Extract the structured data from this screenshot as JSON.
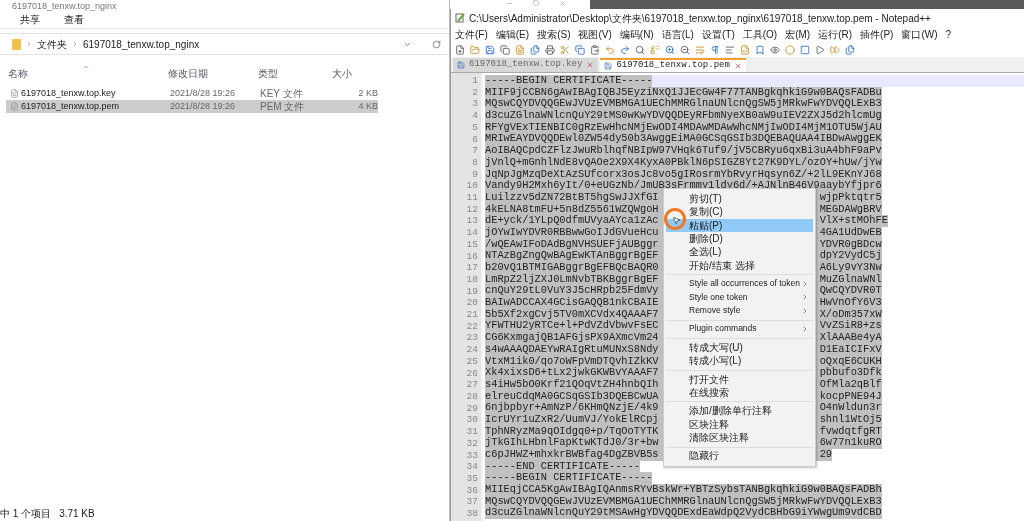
{
  "explorer": {
    "title": "6197018_tenxw.top_nginx",
    "ribbon_tabs": [
      "共享",
      "查看"
    ],
    "breadcrumb": [
      "文件夹",
      "6197018_tenxw.top_nginx"
    ],
    "columns": [
      "名称",
      "修改日期",
      "类型",
      "大小"
    ],
    "files": [
      {
        "name": "6197018_tenxw.top.key",
        "modified": "2021/8/28 19:26",
        "type": "KEY 文件",
        "size": "2 KB",
        "selected": false
      },
      {
        "name": "6197018_tenxw.top.pem",
        "modified": "2021/8/28 19:26",
        "type": "PEM 文件",
        "size": "4 KB",
        "selected": true
      }
    ],
    "status": {
      "count": "中 1 个项目",
      "size": "3.71 KB"
    }
  },
  "notepad": {
    "title": "C:\\Users\\Administrator\\Desktop\\文件夹\\6197018_tenxw.top_nginx\\6197018_tenxw.top.pem - Notepad++",
    "menu": [
      "文件(F)",
      "编辑(E)",
      "搜索(S)",
      "视图(V)",
      "编码(N)",
      "语言(L)",
      "设置(T)",
      "工具(O)",
      "宏(M)",
      "运行(R)",
      "插件(P)",
      "窗口(W)",
      "?"
    ],
    "tabs": [
      {
        "label": "6197018_tenxw.top.key",
        "selected": false
      },
      {
        "label": "6197018_tenxw.top.pem",
        "selected": true
      }
    ],
    "lines": [
      {
        "number": "1",
        "text": "-----BEGIN CERTIFICATE-----",
        "current": true
      },
      {
        "number": "2",
        "text": "MIIF9jCCBN6gAwIBAgIQBJ5EyziNxQ1JJEcGw4F77TANBgkqhkiG9w0BAQsFADBu",
        "current": false
      },
      {
        "number": "3",
        "text": "MQswCQYDVQQGEwJVUzEVMBMGA1UEChMMRGlnaUNlcnQgSW5jMRkwFwYDVQQLExB3",
        "current": false
      },
      {
        "number": "4",
        "text": "d3cuZGlnaWNlcnQuY29tMS0wKwYDVQQDEyRFbmNyeXB0aW9uIEV2ZXJ5d2hlcmUg",
        "current": false
      },
      {
        "number": "5",
        "text": "RFYgVExTIENBIC0gRzEwHhcNMjEwODI4MDAwMDAwWhcNMjIwODI4MjM1OTU5WjAU",
        "current": false
      },
      {
        "number": "6",
        "text": "MRIwEAYDVQQDEwl0ZW54dy50b3AwggEiMA0GCSqGSIb3DQEBAQUAA4IBDwAwggEK",
        "current": false
      },
      {
        "number": "7",
        "text": "AoIBAQCpdCZFlzJwuRblhqfNBIpW97VHqk6Tuf9/jV5CBRyu6qxBi3uA4bhF9aPv",
        "current": false
      },
      {
        "number": "8",
        "text": "jVnlQ+mGnhlNdE8vQAOe2X9X4KyxA0PBklN6pSIGZ8Yt27K9DYL/ozOY+hUw/jYw",
        "current": false
      },
      {
        "number": "9",
        "text": "JqNpJgMzqDeXtAzSUfcorx3osJc8vo5gIRosrmYbRvyrHqsyn6Z/+2lL9EKnYJ68",
        "current": false
      },
      {
        "number": "10",
        "text": "Vandy9H2Mxh6yIt/0+eUGzNb/JmUB3sFrmmy1ldy6d/+AJNlnB46V9aaybYfjpr6",
        "current": false
      },
      {
        "number": "11",
        "text": "Luilzzv5dZN72BtBT5hgSwJJXfGI",
        "tail": "wjpPktqtr5",
        "current": false
      },
      {
        "number": "12",
        "text": "4kELNA8tmFU+5n8dZ5561WZQWgoH",
        "tail": "MEGDAWgBRV",
        "current": false
      },
      {
        "number": "13",
        "text": "dE+yck/1YLpQ0dfmUVyaAYca1zAc",
        "tail": "VlX+stMOhFE",
        "current": false
      },
      {
        "number": "14",
        "text": "jOYwIwYDVR0RBBwwGoIJdGVueHcu",
        "tail": "4GA1UdDwEB",
        "current": false
      },
      {
        "number": "15",
        "text": "/wQEAwIFoDAdBgNVHSUEFjAUBggr",
        "tail": "YDVR0gBDcw",
        "current": false
      },
      {
        "number": "16",
        "text": "NTAzBgZngQwBAgEwKTAnBggrBgEF",
        "tail": "dpY2VydC5j",
        "current": false
      },
      {
        "number": "17",
        "text": "b20vQ1BTMIGABggrBgEFBQcBAQR0",
        "tail": "A6Ly9vY3Nw",
        "current": false
      },
      {
        "number": "18",
        "text": "LmRpZ2ljZXJ0LmNvbTBKBggrBgEF",
        "tail": "MuZGlnaWNl",
        "current": false
      },
      {
        "number": "19",
        "text": "cnQuY29tL0VuY3J5cHRpb25FdmVy",
        "tail": "QwCQYDVR0T",
        "current": false
      },
      {
        "number": "20",
        "text": "BAIwADCCAX4GCisGAQQB1nkCBAIE",
        "tail": "HwVnOfY6V3",
        "current": false
      },
      {
        "number": "21",
        "text": "5b5Xf2xgCvj5TV0mXCVdx4QAAAF7",
        "tail": "X/oDm357xW",
        "current": false
      },
      {
        "number": "22",
        "text": "YFWTHU2yRTCe+l+PdVZdVbwvFsEC",
        "tail": "VvZSiR8+zs",
        "current": false
      },
      {
        "number": "23",
        "text": "CG6KxmgajQB1AFGjsPX9AXmcVm24",
        "tail": "XlAAABe4yA",
        "current": false
      },
      {
        "number": "24",
        "text": "s4wAAAQDAEYwRAIgRtuMUNxS8Ndy",
        "tail": "D1EaICIFxV",
        "current": false
      },
      {
        "number": "25",
        "text": "VtxM1ik0/qo7oWFpVmDTQvhIZkKV",
        "tail": "oQxqE6CUKH",
        "current": false
      },
      {
        "number": "26",
        "text": "Xk4xixsD6+tLx2jwkGKWBvYAAAF7",
        "tail": "pbbufo3Dfk",
        "current": false
      },
      {
        "number": "27",
        "text": "s4iHw5bO0Krf21QOqVtZH4hnbQIh",
        "tail": "OfMla2qBlf",
        "current": false
      },
      {
        "number": "28",
        "text": "elreuCdqMA0GCSqGSIb3DQEBCwUA",
        "tail": "kocpPNE94J",
        "current": false
      },
      {
        "number": "29",
        "text": "6njbpbyr+AmNzP/6KHmQNzjE/4k9",
        "tail": "O4nWldun3r",
        "current": false
      },
      {
        "number": "30",
        "text": "IcrUYr1uZxR2/UumVJ/YokElRCpj",
        "tail": "shnl1WtOj5",
        "current": false
      },
      {
        "number": "31",
        "text": "TphNRyzMa9qOIdgq0+p/TqOoTYTK",
        "tail": "fvwdqtfgRT",
        "current": false
      },
      {
        "number": "32",
        "text": "jTkGIhLHbnlFapKtwKTdJ0/3r+bw",
        "tail": "6w77n1kuRO",
        "current": false
      },
      {
        "number": "33",
        "text": "c6pJHWZ+mhxkrBWBfag4DgZBVB5s",
        "tail": "29",
        "current": false
      },
      {
        "number": "34",
        "text": "-----END CERTIFICATE-----",
        "current": false
      },
      {
        "number": "35",
        "text": "-----BEGIN CERTIFICATE-----",
        "current": false
      },
      {
        "number": "36",
        "text": "MIIEqjCCA5KgAwIBAgIQAnmsRYvBskWr+YBTzSybsTANBgkqhkiG9w0BAQsFADBh",
        "current": false
      },
      {
        "number": "37",
        "text": "MQswCQYDVQQGEwJVUzEVMBMGA1UEChMMRGlnaUNlcnQgSW5jMRkwFwYDVQQLExB3",
        "current": false
      },
      {
        "number": "38",
        "text": "d3cuZGlnaWNlcnQuY29tMSAwHgYDVQQDExdEaWdpQ2VydCBHbG9iYWwgUm9vdCBD",
        "current": false
      }
    ],
    "context_menu": {
      "groups": [
        [
          {
            "label": "剪切(T)",
            "submenu": false,
            "selected": false
          },
          {
            "label": "复制(C)",
            "submenu": false,
            "selected": false
          },
          {
            "label": "粘贴(P)",
            "submenu": false,
            "selected": true
          },
          {
            "label": "删除(D)",
            "submenu": false,
            "selected": false
          },
          {
            "label": "全选(L)",
            "submenu": false,
            "selected": false
          },
          {
            "label": "开始/结束 选择",
            "submenu": false,
            "selected": false
          }
        ],
        [
          {
            "label": "Style all occurrences of token",
            "submenu": true,
            "selected": false
          },
          {
            "label": "Style one token",
            "submenu": true,
            "selected": false
          },
          {
            "label": "Remove style",
            "submenu": true,
            "selected": false
          }
        ],
        [
          {
            "label": "Plugin commands",
            "submenu": true,
            "selected": false
          }
        ],
        [
          {
            "label": "转成大写(U)",
            "submenu": false,
            "selected": false
          },
          {
            "label": "转成小写(L)",
            "submenu": false,
            "selected": false
          }
        ],
        [
          {
            "label": "打开文件",
            "submenu": false,
            "selected": false
          },
          {
            "label": "在线搜索",
            "submenu": false,
            "selected": false
          }
        ],
        [
          {
            "label": "添加/删除单行注释",
            "submenu": false,
            "selected": false
          },
          {
            "label": "区块注释",
            "submenu": false,
            "selected": false
          },
          {
            "label": "清除区块注释",
            "submenu": false,
            "selected": false
          }
        ],
        [
          {
            "label": "隐藏行",
            "submenu": false,
            "selected": false
          }
        ]
      ]
    }
  }
}
